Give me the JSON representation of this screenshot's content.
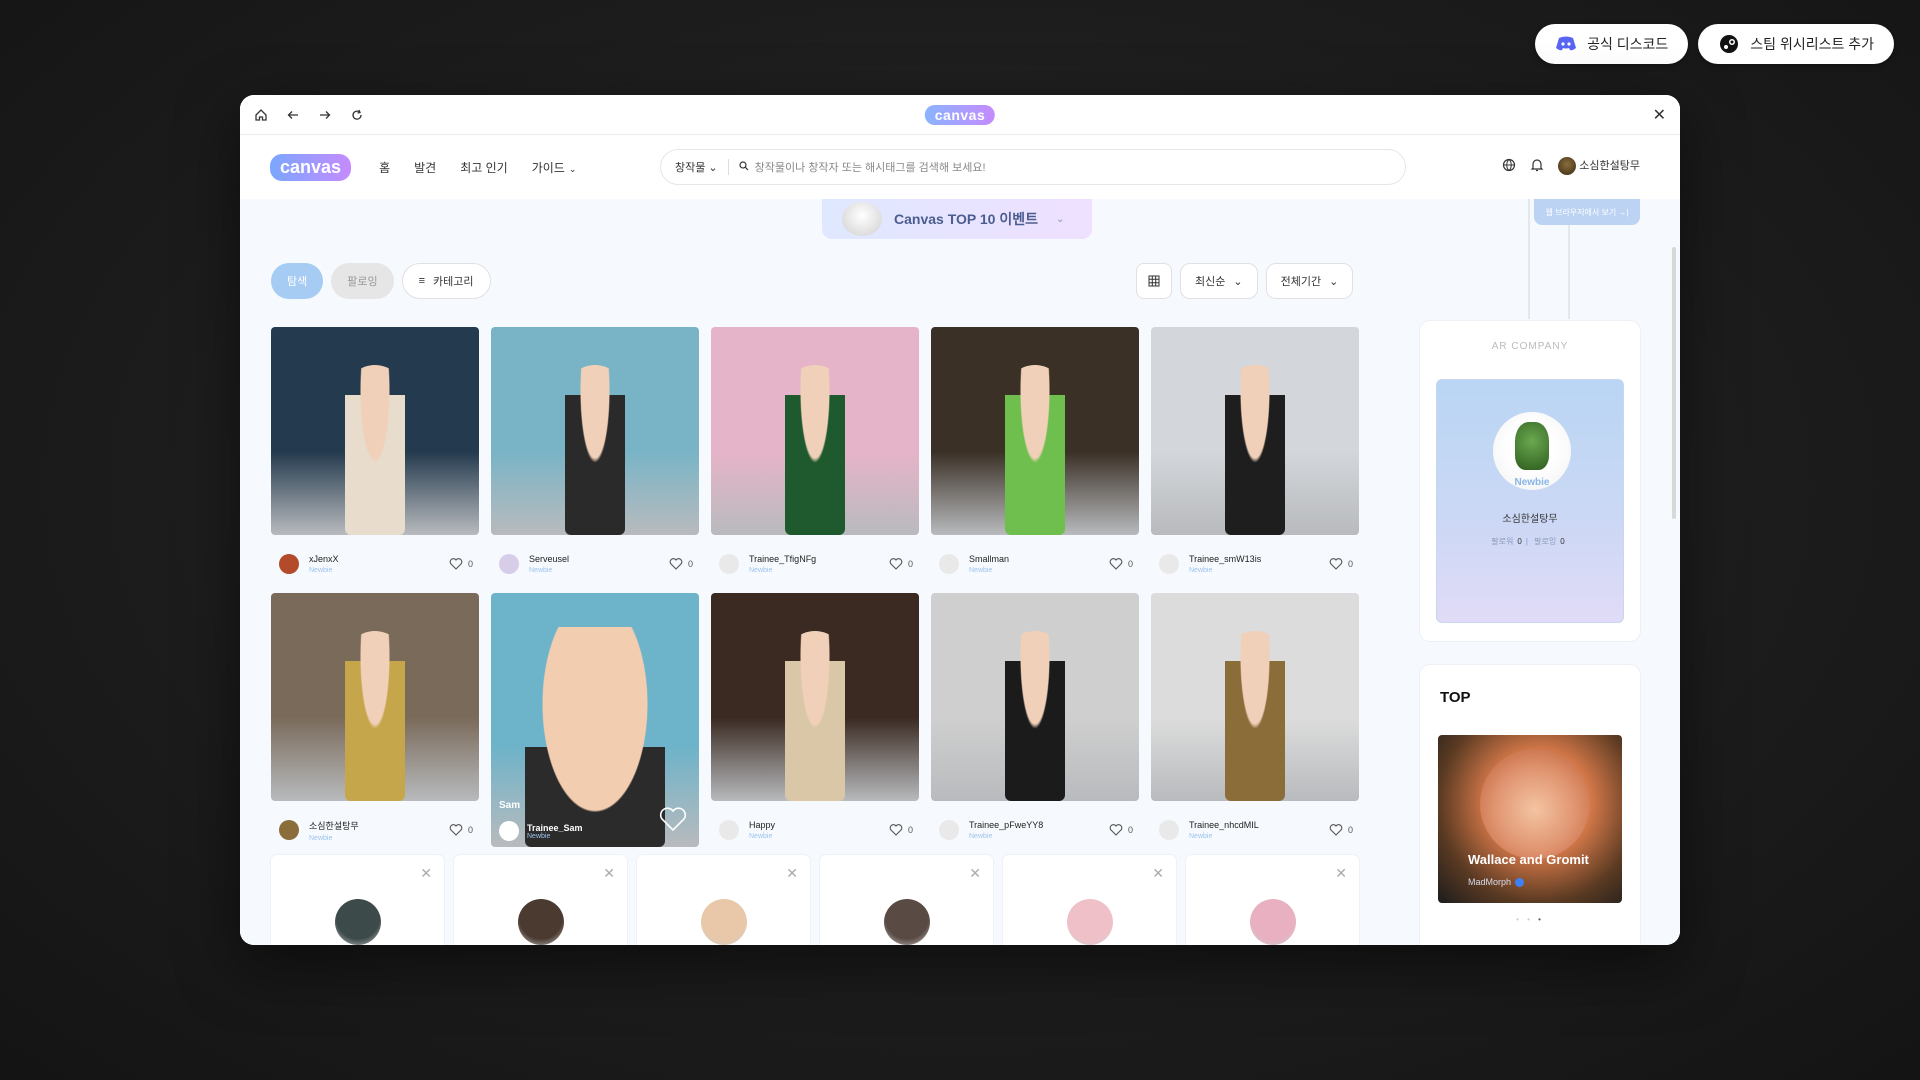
{
  "top_actions": {
    "discord_label": "공식 디스코드",
    "steam_label": "스팀 위시리스트 추가"
  },
  "window": {
    "logo": "canvas"
  },
  "header": {
    "logo": "canvas",
    "nav": [
      "홈",
      "발견",
      "최고 인기",
      "가이드"
    ],
    "search_type": "창작물",
    "search_placeholder": "창작물이나 창작자 또는 해시태그를 검색해 보세요!",
    "username": "소심한설탕무"
  },
  "banner": {
    "label": "Canvas TOP 10 이벤트",
    "side_tag": "웹 브라우저에서 보기 →|"
  },
  "filters": {
    "tab_explore": "탐색",
    "tab_following": "팔로잉",
    "category": "카테고리",
    "sort": "최신순",
    "period": "전체기간"
  },
  "cards": [
    {
      "user": "xJenxX",
      "tier": "Newbie",
      "likes": "0",
      "bg": "#243a4e",
      "fg": "#e8dccd",
      "av": "#b34a2a"
    },
    {
      "user": "Serveusel",
      "tier": "Newbie",
      "likes": "0",
      "bg": "#79b4c6",
      "fg": "#2a2a2a",
      "av": "#d8cde8"
    },
    {
      "user": "Trainee_TfigNFg",
      "tier": "Newbie",
      "likes": "0",
      "bg": "#e6b4c8",
      "fg": "#1f5a2e",
      "av": "#e9e9e9"
    },
    {
      "user": "Smallman",
      "tier": "Newbie",
      "likes": "0",
      "bg": "#3a3026",
      "fg": "#6fbf4e",
      "av": "#e9e9e9"
    },
    {
      "user": "Trainee_smW13is",
      "tier": "Newbie",
      "likes": "0",
      "bg": "#d3d6da",
      "fg": "#1e1e1e",
      "av": "#e9e9e9"
    },
    {
      "user": "소심한설탕무",
      "tier": "Newbie",
      "likes": "0",
      "bg": "#7a6a5a",
      "fg": "#c5a64a",
      "av": "#8a6d3b"
    },
    {
      "user": "Trainee_Sam",
      "tier": "Newbie",
      "likes": "",
      "bg": "#6db3c9",
      "fg": "#f0c8a8",
      "av": "#ffffff",
      "featured": true,
      "title": "Sam"
    },
    {
      "user": "Happy",
      "tier": "Newbie",
      "likes": "0",
      "bg": "#3a2a22",
      "fg": "#d9c7a8",
      "av": "#e9e9e9"
    },
    {
      "user": "Trainee_pFweYY8",
      "tier": "Newbie",
      "likes": "0",
      "bg": "#cfcfcf",
      "fg": "#1b1b1b",
      "av": "#e9e9e9"
    },
    {
      "user": "Trainee_nhcdMIL",
      "tier": "Newbie",
      "likes": "0",
      "bg": "#dcdcdc",
      "fg": "#8b6d3a",
      "av": "#e9e9e9"
    }
  ],
  "recommended": [
    {
      "color": "#3d4a4a"
    },
    {
      "color": "#4a3a30"
    },
    {
      "color": "#e8c8a8"
    },
    {
      "color": "#5a4a44"
    },
    {
      "color": "#f0c0c8"
    },
    {
      "color": "#e8b0c0"
    }
  ],
  "profile": {
    "company": "AR COMPANY",
    "badge": "Newbie",
    "name": "소심한설탕무",
    "followers_label": "팔로워",
    "followers": "0",
    "following_label": "팔로잉",
    "following": "0"
  },
  "top": {
    "title": "TOP",
    "hero_title": "Wallace and Gromit",
    "hero_user": "MadMorph"
  }
}
